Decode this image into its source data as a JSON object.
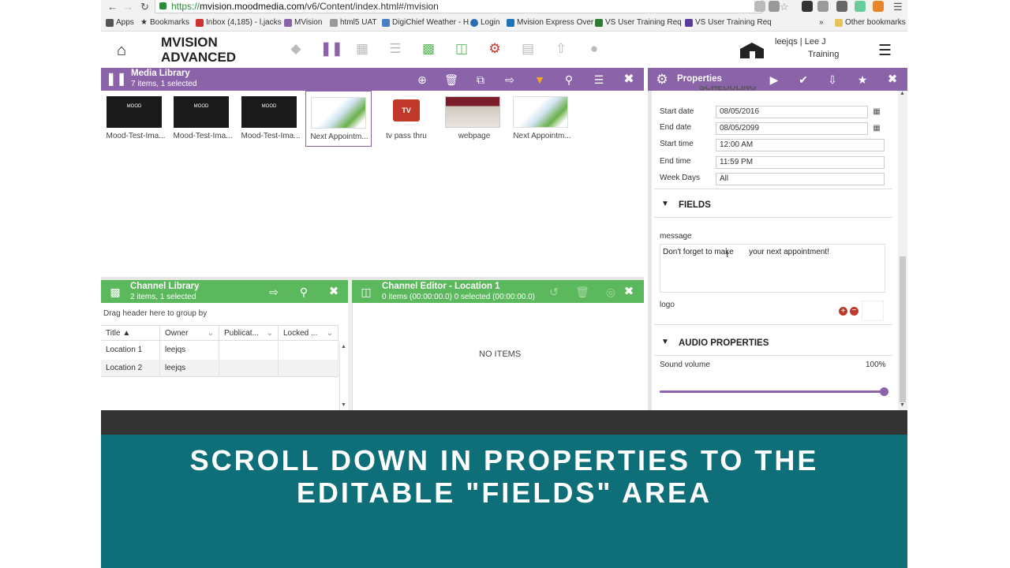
{
  "browser": {
    "url_protocol": "https://",
    "url_host": "mvision.moodmedia.com",
    "url_path": "/v6/Content/index.html#/mvision",
    "bookmarks": [
      "Apps",
      "Bookmarks",
      "Inbox (4,185) - l.jacks",
      "MVision",
      "html5 UAT",
      "DigiChief Weather - H",
      "Login",
      "Mvision Express Over",
      "VS User Training Req",
      "VS User Training Req"
    ],
    "other_bookmarks": "Other bookmarks",
    "overflow": "»"
  },
  "header": {
    "brand_line1": "MVISION",
    "brand_line2": "ADVANCED",
    "user": "leejqs  |  Lee J",
    "role": "Training"
  },
  "media_library": {
    "title": "Media Library",
    "subtitle": "7 items, 1 selected",
    "items": [
      {
        "name": "Mood-Test-Ima...",
        "thumb_text": "MOOD"
      },
      {
        "name": "Mood-Test-Ima...",
        "thumb_text": "MOOD"
      },
      {
        "name": "Mood-Test-Ima...",
        "thumb_text": "MOOD"
      },
      {
        "name": "Next Appointm...",
        "thumb_text": ""
      },
      {
        "name": "tv pass thru",
        "thumb_text": "TV"
      },
      {
        "name": "webpage",
        "thumb_text": ""
      },
      {
        "name": "Next Appointm...",
        "thumb_text": ""
      }
    ]
  },
  "channel_library": {
    "title": "Channel Library",
    "subtitle": "2 items, 1 selected",
    "group_hint": "Drag header here to group by",
    "columns": [
      "Title",
      "Owner",
      "Publicat...",
      "Locked ..."
    ],
    "rows": [
      {
        "title": "Location 1",
        "owner": "leejqs"
      },
      {
        "title": "Location 2",
        "owner": "leejqs"
      }
    ]
  },
  "channel_editor": {
    "title": "Channel Editor - Location 1",
    "subtitle": "0 items (00:00:00.0) 0 selected (00:00:00.0)",
    "empty": "NO ITEMS"
  },
  "properties": {
    "title": "Properties",
    "scheduling_partial": "SCHEDULING",
    "start_date_label": "Start date",
    "start_date": "08/05/2016",
    "end_date_label": "End date",
    "end_date": "08/05/2099",
    "start_time_label": "Start time",
    "start_time": "12:00 AM",
    "end_time_label": "End time",
    "end_time": "11:59 PM",
    "weekdays_label": "Week Days",
    "weekdays": "All",
    "fields_header": "FIELDS",
    "message_label": "message",
    "message_value": "Don't forget to make       your next appointment!",
    "logo_label": "logo",
    "audio_header": "AUDIO PROPERTIES",
    "volume_label": "Sound volume",
    "volume_value": "100%",
    "volume_fraction": 1.0
  },
  "banner": {
    "line1": "SCROLL DOWN IN PROPERTIES TO THE",
    "line2": "EDITABLE \"FIELDS\" AREA"
  },
  "colors": {
    "purple": "#8a63a8",
    "green": "#5cb85c",
    "teal": "#0e6f79"
  }
}
